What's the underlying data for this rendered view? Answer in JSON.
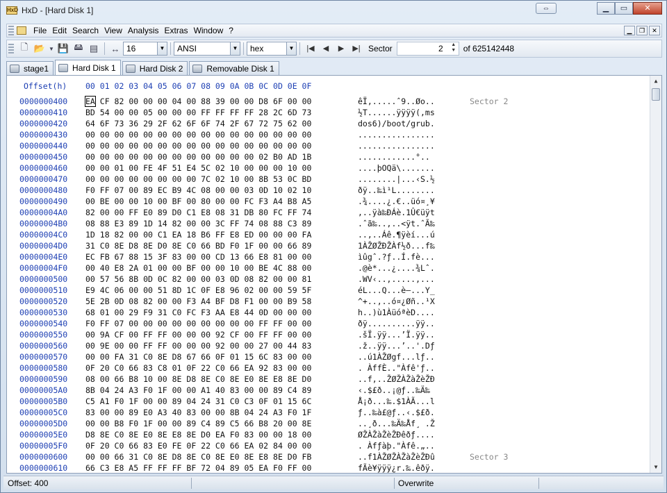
{
  "window": {
    "title": "HxD - [Hard Disk 1]",
    "app_icon_text": "HxD"
  },
  "menu": [
    "File",
    "Edit",
    "Search",
    "View",
    "Analysis",
    "Extras",
    "Window",
    "?"
  ],
  "toolbar": {
    "bytes_per_row": "16",
    "charset": "ANSI",
    "offset_base": "hex",
    "sector_label": "Sector",
    "sector_value": "2",
    "sector_total": "of 625142448"
  },
  "tabs": [
    {
      "label": "stage1",
      "active": false
    },
    {
      "label": "Hard Disk 1",
      "active": true
    },
    {
      "label": "Hard Disk 2",
      "active": false
    },
    {
      "label": "Removable Disk 1",
      "active": false
    }
  ],
  "hex_header": {
    "offset_label": "Offset(h)",
    "columns": "00 01 02 03 04 05 06 07 08 09 0A 0B 0C 0D 0E 0F"
  },
  "rows": [
    {
      "offset": "0000000400",
      "hex": "EA CF 82 00 00 00 04 00 88 39 00 00 D8 6F 00 00",
      "text": "êÏ‚.....ˆ9..Øo..",
      "sector": "Sector 2"
    },
    {
      "offset": "0000000410",
      "hex": "BD 54 00 00 05 00 00 00 FF FF FF FF 28 2C 6D 73",
      "text": "½T......ÿÿÿÿ(,ms",
      "sector": ""
    },
    {
      "offset": "0000000420",
      "hex": "64 6F 73 36 29 2F 62 6F 6F 74 2F 67 72 75 62 00",
      "text": "dos6)/boot/grub.",
      "sector": ""
    },
    {
      "offset": "0000000430",
      "hex": "00 00 00 00 00 00 00 00 00 00 00 00 00 00 00 00",
      "text": "................",
      "sector": ""
    },
    {
      "offset": "0000000440",
      "hex": "00 00 00 00 00 00 00 00 00 00 00 00 00 00 00 00",
      "text": "................",
      "sector": ""
    },
    {
      "offset": "0000000450",
      "hex": "00 00 00 00 00 00 00 00 00 00 00 00 02 B0 AD 1B",
      "text": "............°..",
      "sector": ""
    },
    {
      "offset": "0000000460",
      "hex": "00 00 01 00 FE 4F 51 E4 5C 02 10 00 00 00 10 00",
      "text": "....þOQä\\.......",
      "sector": ""
    },
    {
      "offset": "0000000470",
      "hex": "00 00 00 00 00 00 00 00 7C 02 10 00 8B 53 0C BD",
      "text": "........|...‹S.½",
      "sector": ""
    },
    {
      "offset": "0000000480",
      "hex": "F0 FF 07 00 89 EC B9 4C 08 00 00 03 0D 10 02 10",
      "text": "ðÿ..‰ì¹L........",
      "sector": ""
    },
    {
      "offset": "0000000490",
      "hex": "00 BE 00 00 10 00 BF 00 80 00 00 FC F3 A4 B8 A5",
      "text": ".¾....¿.€..üó¤¸¥",
      "sector": ""
    },
    {
      "offset": "00000004A0",
      "hex": "82 00 00 FF E0 89 D0 C1 E8 08 31 DB 80 FC FF 74",
      "text": ",..ÿà‰ÐÁè.1Û€üÿt",
      "sector": ""
    },
    {
      "offset": "00000004B0",
      "hex": "08 88 E3 89 1D 14 82 00 00 3C FF 74 08 88 C3 89",
      "text": ".ˆã‰..‚..<ÿt.ˆÃ‰",
      "sector": ""
    },
    {
      "offset": "00000004C0",
      "hex": "1D 18 82 00 00 C1 EA 18 B6 FF E8 ED 00 00 00 FA",
      "text": "..‚..Áê.¶ÿèí...ú",
      "sector": ""
    },
    {
      "offset": "00000004D0",
      "hex": "31 C0 8E D8 8E D0 8E C0 66 BD F0 1F 00 00 66 89",
      "text": "1ÀŽØŽÐŽÀf½ð...f‰",
      "sector": ""
    },
    {
      "offset": "00000004E0",
      "hex": "EC FB 67 88 15 3F 83 00 00 CD 13 66 E8 81 00 00",
      "text": "ìûgˆ.?ƒ..Í.fè...",
      "sector": ""
    },
    {
      "offset": "00000004F0",
      "hex": "00 40 E8 2A 01 00 00 BF 00 00 10 00 BE 4C 88 00",
      "text": ".@è*...¿....¾Lˆ.",
      "sector": ""
    },
    {
      "offset": "0000000500",
      "hex": "00 57 56 8B 0D 0C 82 00 00 03 0D 08 82 00 00 81",
      "text": ".WV‹..‚.....‚...",
      "sector": ""
    },
    {
      "offset": "0000000510",
      "hex": "E9 4C 06 00 00 51 8D 1C 0F E8 96 02 00 00 59 5F",
      "text": "éL...Q...è–...Y_",
      "sector": ""
    },
    {
      "offset": "0000000520",
      "hex": "5E 2B 0D 08 82 00 00 F3 A4 BF D8 F1 00 00 B9 58",
      "text": "^+..‚..ó¤¿Øñ..¹X",
      "sector": ""
    },
    {
      "offset": "0000000530",
      "hex": "68 01 00 29 F9 31 C0 FC F3 AA E8 44 0D 00 00 00",
      "text": "h..)ù1ÀüóªèD....",
      "sector": ""
    },
    {
      "offset": "0000000540",
      "hex": "F0 FF 07 00 00 00 00 00 00 00 00 00 FF FF 00 00",
      "text": "ðÿ..........ÿÿ..",
      "sector": ""
    },
    {
      "offset": "0000000550",
      "hex": "00 9A CF 00 FF FF 00 00 00 92 CF 00 FF FF 00 00",
      "text": ".šÏ.ÿÿ...’Ï.ÿÿ..",
      "sector": ""
    },
    {
      "offset": "0000000560",
      "hex": "00 9E 00 00 FF FF 00 00 00 92 00 00 27 00 44 83",
      "text": ".ž..ÿÿ...’..'.Dƒ",
      "sector": ""
    },
    {
      "offset": "0000000570",
      "hex": "00 00 FA 31 C0 8E D8 67 66 0F 01 15 6C 83 00 00",
      "text": "..ú1ÀŽØgf...lƒ..",
      "sector": ""
    },
    {
      "offset": "0000000580",
      "hex": "0F 20 C0 66 83 C8 01 0F 22 C0 66 EA 92 83 00 00",
      "text": ". ÀffÈ..\"Àfê'ƒ..",
      "sector": ""
    },
    {
      "offset": "0000000590",
      "hex": "08 00 66 B8 10 00 8E D8 8E C0 8E E0 8E E8 8E D0",
      "text": "..f,..ŽØŽÀŽàŽèŽÐ",
      "sector": ""
    },
    {
      "offset": "00000005A0",
      "hex": "8B 04 24 A3 F0 1F 00 00 A1 40 83 00 00 89 C4 89",
      "text": "‹.$£ð..¡@ƒ..‰Ä‰",
      "sector": ""
    },
    {
      "offset": "00000005B0",
      "hex": "C5 A1 F0 1F 00 00 89 04 24 31 C0 C3 0F 01 15 6C",
      "text": "Å¡ð...‰.$1ÀÃ...l",
      "sector": ""
    },
    {
      "offset": "00000005C0",
      "hex": "83 00 00 89 E0 A3 40 83 00 00 8B 04 24 A3 F0 1F",
      "text": "ƒ..‰à£@ƒ..‹.$£ð.",
      "sector": ""
    },
    {
      "offset": "00000005D0",
      "hex": "00 00 B8 F0 1F 00 00 89 C4 89 C5 66 B8 20 00 8E",
      "text": "..¸ð...‰Ä‰Åf¸ .Ž",
      "sector": ""
    },
    {
      "offset": "00000005E0",
      "hex": "D8 8E C0 8E E0 8E E8 8E D0 EA F0 83 00 00 18 00",
      "text": "ØŽÀŽàŽèŽÐêðƒ....",
      "sector": ""
    },
    {
      "offset": "00000005F0",
      "hex": "0F 20 C0 66 83 E0 FE 0F 22 C0 66 EA 02 84 00 00",
      "text": ". Àfƒàþ.\"Àfê.„..",
      "sector": ""
    },
    {
      "offset": "0000000600",
      "hex": "00 00 66 31 C0 8E D8 8E C0 8E E0 8E E8 8E D0 FB",
      "text": "..f1ÀŽØŽÀŽàŽèŽÐû",
      "sector": "Sector 3"
    },
    {
      "offset": "0000000610",
      "hex": "66 C3 E8 A5 FF FF FF BF 72 04 89 05 EA F0 FF 00",
      "text": "fÃè¥ÿÿÿ¿r.‰.êðÿ.",
      "sector": ""
    }
  ],
  "status": {
    "offset": "Offset: 400",
    "mode": "Overwrite"
  },
  "colors": {
    "offset_blue": "#1d3fb3",
    "sector_gray": "#888888"
  }
}
